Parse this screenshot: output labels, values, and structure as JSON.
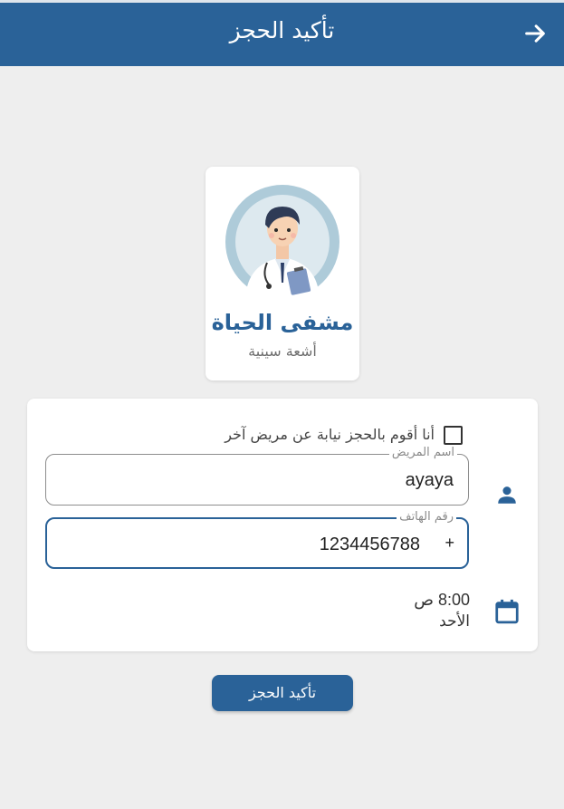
{
  "header": {
    "title": "تأكيد الحجز",
    "back_icon": "arrow-right-icon"
  },
  "hospital": {
    "name": "مشفى الحياة",
    "specialty": "أشعة سينية",
    "avatar_icon": "doctor-illustration"
  },
  "form": {
    "on_behalf_checked": false,
    "on_behalf_label": "أنا أقوم بالحجز نيابة عن مريض آخر",
    "patient_name_label": "اسم المريض",
    "patient_name_value": "ayaya",
    "phone_label": "رقم الهاتف",
    "phone_prefix": "+",
    "phone_value": "1234456788",
    "time": "8:00 ص",
    "day": "الأحد",
    "person_icon": "person-icon",
    "calendar_icon": "calendar-icon"
  },
  "confirm_button": "تأكيد الحجز",
  "colors": {
    "primary": "#2a6298",
    "background": "#eeeeee"
  }
}
